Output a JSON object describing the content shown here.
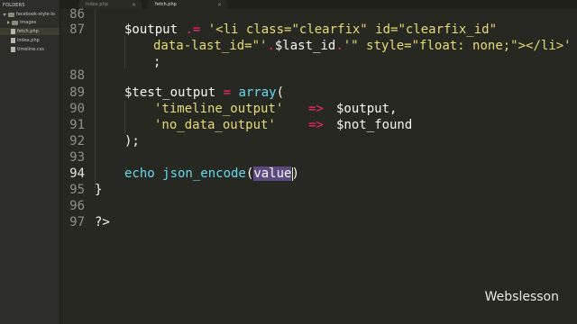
{
  "sidebar": {
    "title": "FOLDERS",
    "root": "facebook-style-lo",
    "items": [
      {
        "label": "images",
        "kind": "folder"
      },
      {
        "label": "fetch.php",
        "kind": "file"
      },
      {
        "label": "index.php",
        "kind": "file"
      },
      {
        "label": "timeline.css",
        "kind": "file"
      }
    ]
  },
  "tabs": [
    {
      "label": "index.php"
    },
    {
      "label": "fetch.php"
    }
  ],
  "editor": {
    "lines": [
      {
        "num": "86"
      },
      {
        "num": "87"
      },
      {
        "num": ""
      },
      {
        "num": "88"
      },
      {
        "num": "89"
      },
      {
        "num": "90"
      },
      {
        "num": "91"
      },
      {
        "num": "92"
      },
      {
        "num": "93"
      },
      {
        "num": "94"
      },
      {
        "num": "95"
      },
      {
        "num": "96"
      },
      {
        "num": "97"
      }
    ],
    "code": {
      "l87_a": "$output ",
      "l87_op": ".=",
      "l87_s1": " '<li class=\"clearfix\" id=\"clearfix_id\"",
      "l87b_s": "data-last_id=\"'",
      "l87b_op": ".",
      "l87b_v": "$last_id",
      "l87b_op2": ".",
      "l87b_s2": "'\" style=\"float: none;\"></li>'",
      "l87c": ";",
      "l89_v": "$test_output ",
      "l89_op": "=",
      "l89_fn": " array",
      "l89_p": "(",
      "l90_s": "'timeline_output'",
      "l90_op": "=>",
      "l90_v": "$output,",
      "l91_s": "'no_data_output'",
      "l91_op": "=>",
      "l91_v": "$not_found",
      "l92": ");",
      "l94_kw": "echo",
      "l94_fn": " json_encode",
      "l94_p1": "(",
      "l94_sel": "value",
      "l94_p2": ")",
      "l95": "}",
      "l97": "?>"
    }
  },
  "watermark": "Webslesson"
}
